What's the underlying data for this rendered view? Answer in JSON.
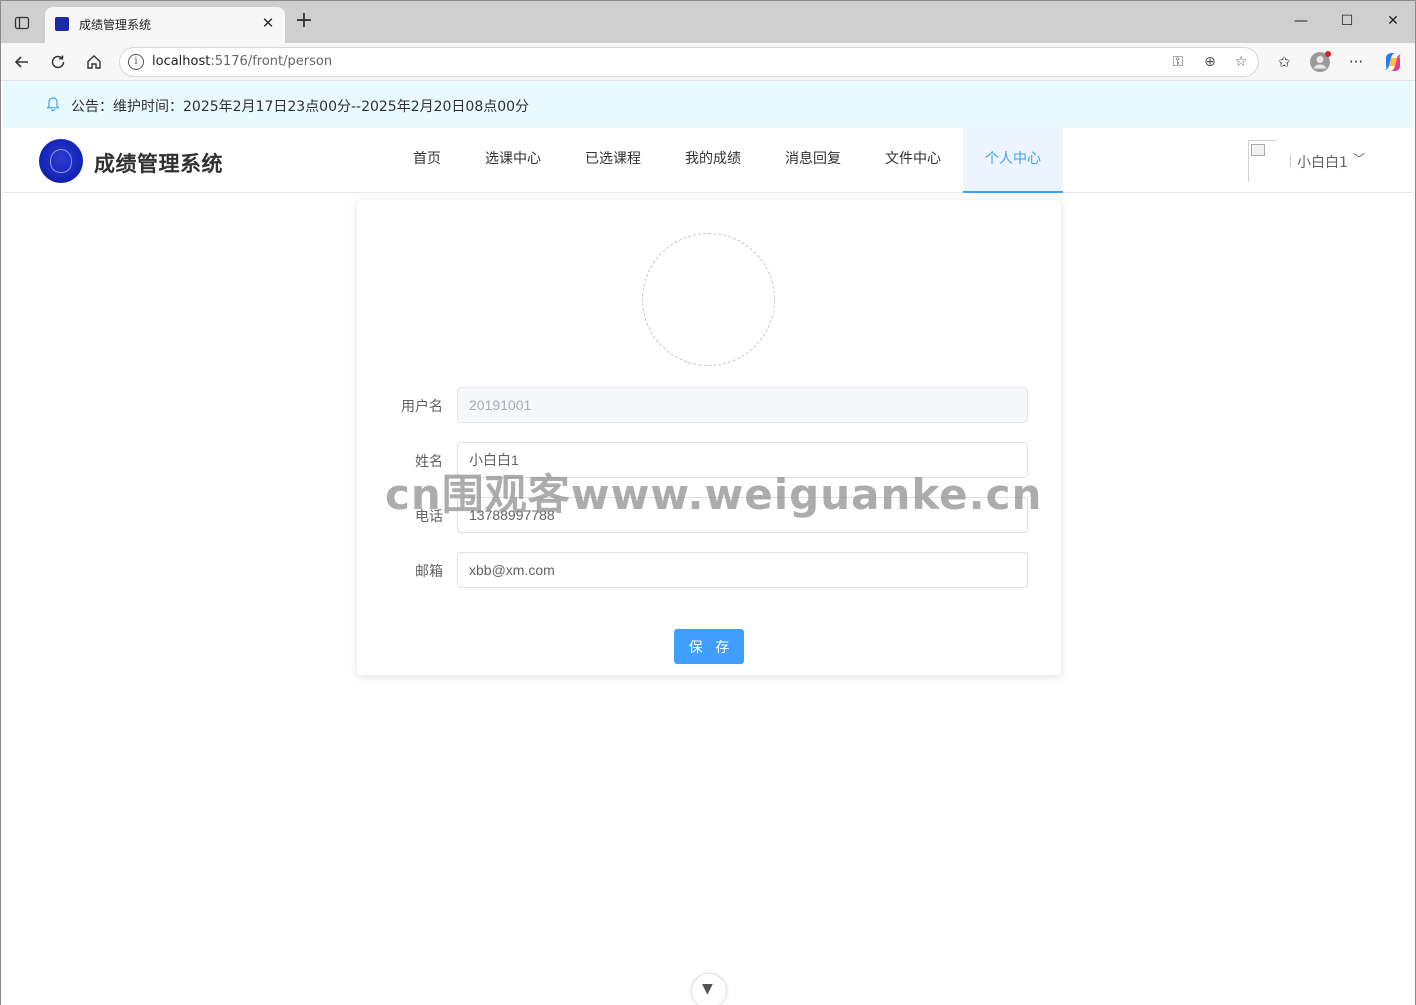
{
  "browser": {
    "tab_title": "成绩管理系统",
    "url_host": "localhost",
    "url_path": ":5176/front/person",
    "icons": {
      "tab_actions": "tab-actions-icon",
      "close_tab": "close-icon",
      "new_tab": "plus-icon",
      "minimize": "minimize-icon",
      "maximize": "maximize-icon",
      "close_window": "close-icon",
      "back": "back-arrow-icon",
      "reload": "reload-icon",
      "home": "home-icon",
      "site_info": "info-icon",
      "key": "key-icon",
      "zoom": "zoom-icon",
      "favorite": "star-icon",
      "favorites": "favorites-icon",
      "profile": "profile-icon",
      "more": "more-icon",
      "copilot": "copilot-icon"
    }
  },
  "notice": {
    "text": "公告：维护时间：2025年2月17日23点00分--2025年2月20日08点00分",
    "icon": "bell-icon"
  },
  "header": {
    "brand": "成绩管理系统",
    "menu": [
      {
        "label": "首页",
        "active": false
      },
      {
        "label": "选课中心",
        "active": false
      },
      {
        "label": "已选课程",
        "active": false
      },
      {
        "label": "我的成绩",
        "active": false
      },
      {
        "label": "消息回复",
        "active": false
      },
      {
        "label": "文件中心",
        "active": false
      },
      {
        "label": "个人中心",
        "active": true
      }
    ],
    "user_name": "小白白1"
  },
  "form": {
    "username_label": "用户名",
    "username_value": "20191001",
    "name_label": "姓名",
    "name_value": "小白白1",
    "phone_label": "电话",
    "phone_value": "13788997788",
    "email_label": "邮箱",
    "email_value": "xbb@xm.com",
    "save_label": "保 存"
  },
  "watermark": "cn围观客www.weiguanke.cn",
  "colors": {
    "accent": "#409eff",
    "notice_bg": "#e9fafe",
    "menu_active_bg": "#ecf5ff"
  }
}
